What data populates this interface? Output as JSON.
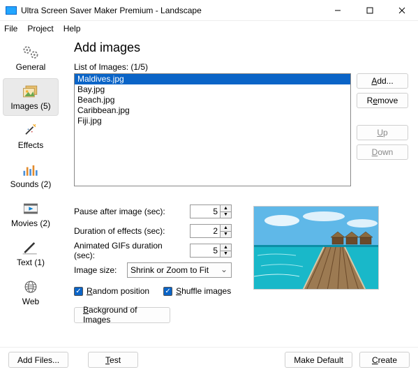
{
  "window": {
    "title": "Ultra Screen Saver Maker Premium - Landscape"
  },
  "menu": {
    "file": "File",
    "project": "Project",
    "help": "Help"
  },
  "sidebar": {
    "items": [
      {
        "label": "General",
        "icon": "gears"
      },
      {
        "label": "Images (5)",
        "icon": "images"
      },
      {
        "label": "Effects",
        "icon": "sparkle"
      },
      {
        "label": "Sounds (2)",
        "icon": "equalizer"
      },
      {
        "label": "Movies (2)",
        "icon": "film"
      },
      {
        "label": "Text (1)",
        "icon": "pencil"
      },
      {
        "label": "Web",
        "icon": "globe"
      }
    ]
  },
  "main": {
    "heading": "Add images",
    "list_label": "List of Images:  (1/5)",
    "images": [
      "Maldives.jpg",
      "Bay.jpg",
      "Beach.jpg",
      "Caribbean.jpg",
      "Fiji.jpg"
    ],
    "buttons": {
      "add": "Add...",
      "remove": "Remove",
      "up": "Up",
      "down": "Down"
    },
    "pause_label": "Pause after image (sec):",
    "pause_value": "5",
    "dur_label": "Duration of effects (sec):",
    "dur_value": "2",
    "gif_label": "Animated GIFs duration (sec):",
    "gif_value": "5",
    "size_label": "Image size:",
    "size_value": "Shrink or Zoom to Fit",
    "random_label": "Random position",
    "shuffle_label": "Shuffle images",
    "bg_button": "Background of Images"
  },
  "footer": {
    "add_files": "Add Files...",
    "test": "Test",
    "make_default": "Make Default",
    "create": "Create"
  }
}
